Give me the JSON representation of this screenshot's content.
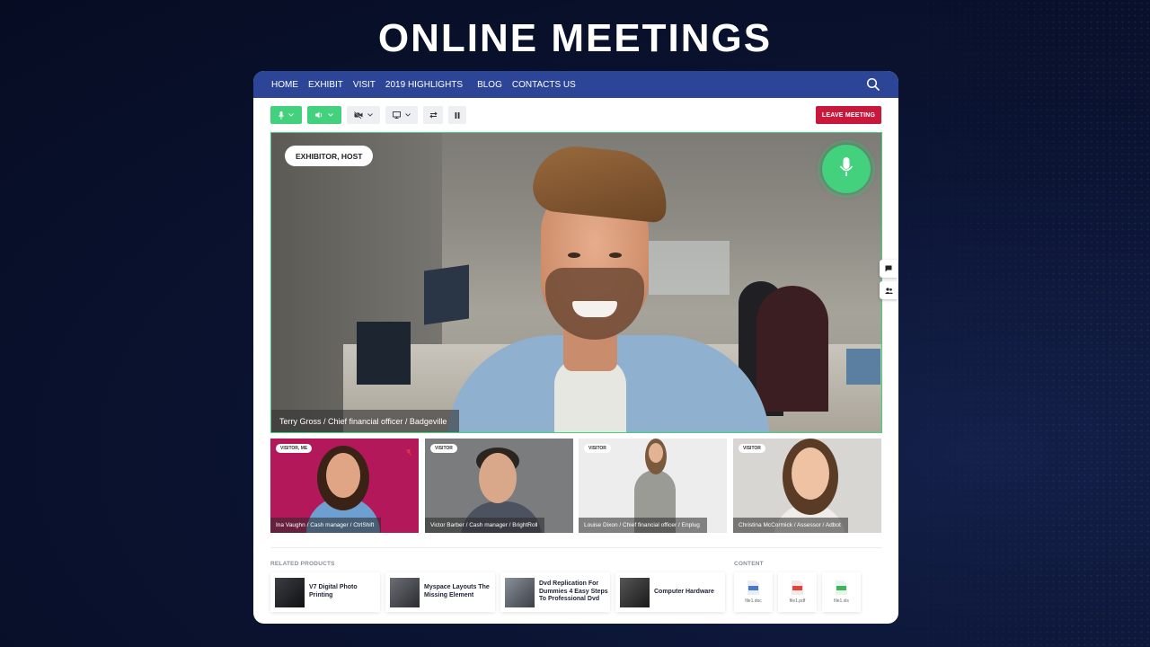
{
  "hero": {
    "title": "ONLINE MEETINGS"
  },
  "nav": {
    "items": [
      "HOME",
      "EXHIBIT",
      "VISIT",
      "2019 HIGHLIGHTS",
      "BLOG",
      "CONTACTS US"
    ],
    "search_icon": "search-icon"
  },
  "toolbar": {
    "mic_icon": "microphone-icon",
    "speaker_icon": "speaker-icon",
    "camera_icon": "camera-off-icon",
    "screen_icon": "monitor-icon",
    "swap_icon": "swap-icon",
    "pause_icon": "pause-icon",
    "leave_label": "LEAVE MEETING",
    "colors": {
      "active": "#43d17d",
      "leave": "#c8193c"
    }
  },
  "main_video": {
    "role": "EXHIBITOR, HOST",
    "caption": "Terry Gross / Chief financial officer / Badgeville",
    "speaking_icon": "microphone-icon"
  },
  "side_tabs": [
    "chat-icon",
    "participants-icon"
  ],
  "participants": [
    {
      "tag": "VISITOR, ME",
      "caption": "Ina Vaughn / Cash manager / CtrlShift",
      "muted_icon": "mic-off-icon"
    },
    {
      "tag": "VISITOR",
      "caption": "Victor Barber / Cash manager / BrightRoll"
    },
    {
      "tag": "VISITOR",
      "caption": "Louise Dixon / Chief financial officer / Enplug"
    },
    {
      "tag": "VISITOR",
      "caption": "Christina McCormick / Assessor / Adbot"
    }
  ],
  "related": {
    "title": "RELATED PRODUCTS",
    "items": [
      {
        "title": "V7 Digital Photo Printing"
      },
      {
        "title": "Myspace Layouts The Missing Element"
      },
      {
        "title": "Dvd Replication For Dummies 4 Easy Steps To Professional Dvd"
      },
      {
        "title": "Computer Hardware"
      }
    ]
  },
  "content": {
    "title": "CONTENT",
    "files": [
      {
        "name": "file1.doc",
        "type": "DOC",
        "color": "#4a78c8"
      },
      {
        "name": "file1.pdf",
        "type": "PDF",
        "color": "#e0443a"
      },
      {
        "name": "file1.xls",
        "type": "XLS",
        "color": "#3fb45a"
      }
    ]
  }
}
